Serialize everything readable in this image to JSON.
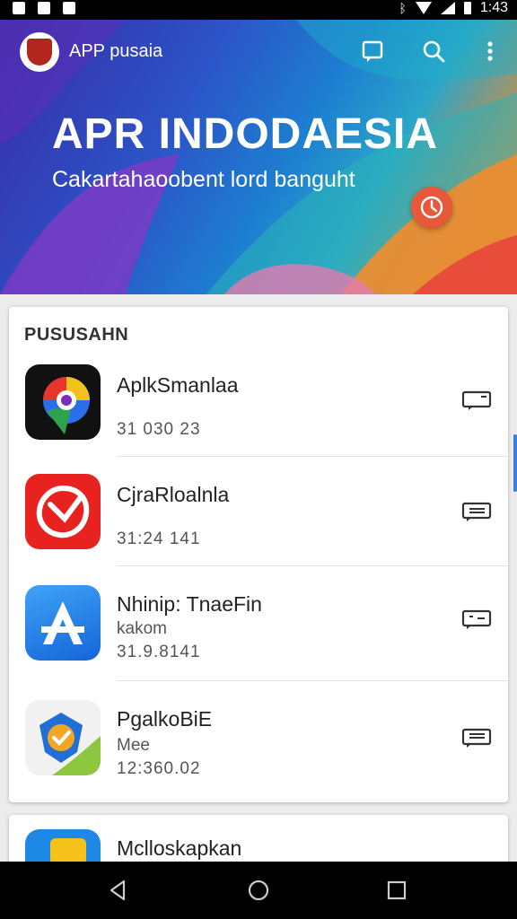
{
  "status_bar": {
    "time": "1:43"
  },
  "app_bar": {
    "app_name": "APP pusaia"
  },
  "hero": {
    "title": "APR INDODAESIA",
    "subtitle": "Cakartahaoobent lord banguht"
  },
  "section": {
    "title": "PUSUSAHN",
    "items": [
      {
        "title": "AplkSmanlaa",
        "subtitle": "",
        "date": "31 030 23"
      },
      {
        "title": "CjraRloalnla",
        "subtitle": "",
        "date": "31:24 141"
      },
      {
        "title": "Nhinip: TnaeFin",
        "subtitle": "kakom",
        "date": "31.9.8141"
      },
      {
        "title": "PgalkoBiE",
        "subtitle": "Mee",
        "date": "12:360.02"
      }
    ]
  },
  "partial_item": {
    "title": "Mclloskapkan"
  },
  "colors": {
    "accent": "#1e88e5",
    "hero_orange": "#f08a2a",
    "badge": "#e8583b"
  }
}
